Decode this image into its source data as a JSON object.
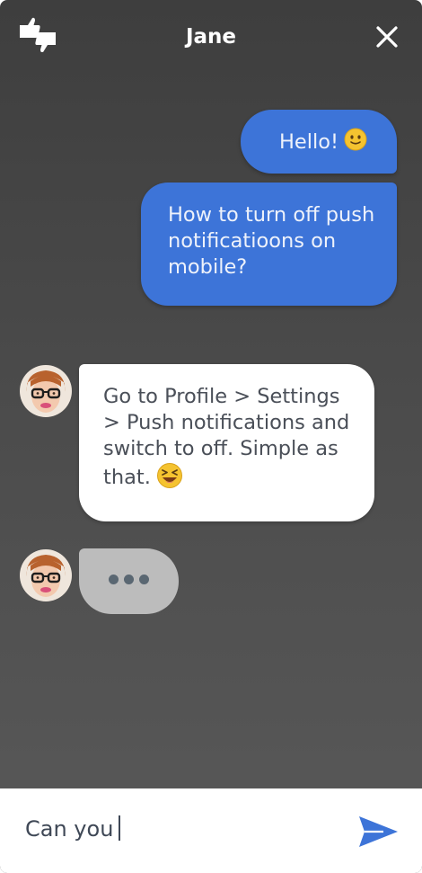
{
  "header": {
    "title": "Jane",
    "feedback_icon": "thumbs-up-down-icon",
    "close_icon": "close-icon"
  },
  "messages": [
    {
      "direction": "outgoing",
      "text": "Hello!",
      "emoji_icon": "slightly-smiling-face-icon"
    },
    {
      "direction": "outgoing",
      "text": "How to turn off push notificatioons on mobile?"
    },
    {
      "direction": "incoming",
      "text": "Go to Profile > Settings > Push notifications and switch to off. Simple as that.",
      "emoji_icon": "laughing-face-icon",
      "avatar_icon": "jane-avatar"
    }
  ],
  "typing_indicator": {
    "avatar_icon": "jane-avatar",
    "icon": "typing-dots-icon"
  },
  "composer": {
    "value": "Can you",
    "send_icon": "send-icon"
  },
  "colors": {
    "outgoing_bubble": "#3d74d8",
    "incoming_bubble": "#ffffff",
    "typing_bubble": "#bcbcbc",
    "send_icon": "#3d74d8"
  }
}
